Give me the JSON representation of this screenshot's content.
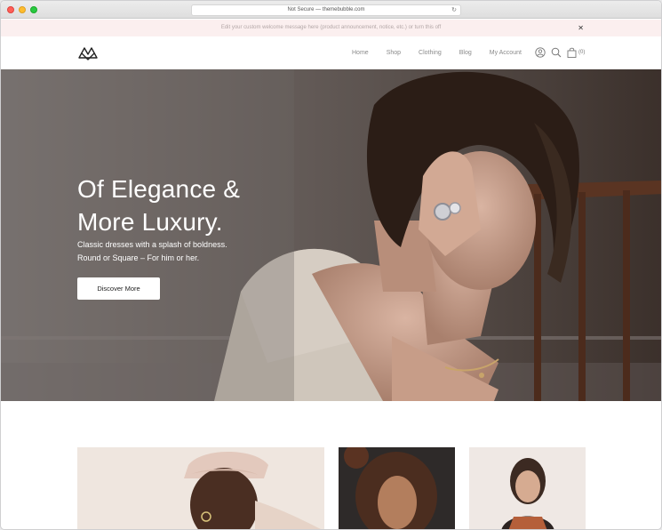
{
  "browser": {
    "url": "Not Secure — themebubble.com"
  },
  "announcement": {
    "text": "Edit your custom welcome message here (product announcement, notice, etc.) or turn this off",
    "close": "✕"
  },
  "header": {
    "nav": [
      "Home",
      "Shop",
      "Clothing",
      "Blog",
      "My Account"
    ],
    "cart_count": "(0)"
  },
  "hero": {
    "title_line1": "Of Elegance &",
    "title_line2": "More Luxury.",
    "subtitle_line1": "Classic dresses with a splash of boldness.",
    "subtitle_line2": "Round or Square – For him or her.",
    "button": "Discover More"
  },
  "icons": [
    "logo-icon",
    "account-icon",
    "search-icon",
    "cart-icon",
    "reload-icon"
  ]
}
